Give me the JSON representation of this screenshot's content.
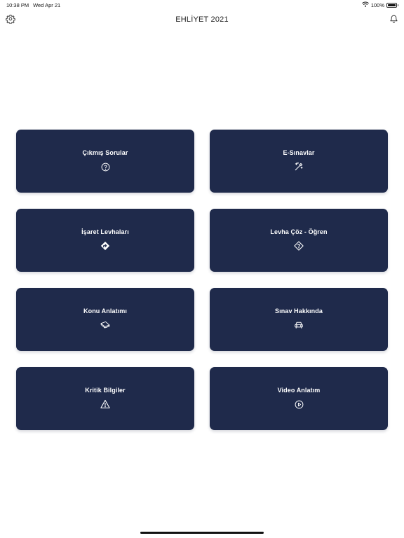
{
  "status": {
    "time": "10:38 PM",
    "date": "Wed Apr 21",
    "battery": "100%"
  },
  "header": {
    "title": "EHLİYET 2021",
    "left_icon": "gear-icon",
    "right_icon": "bell-icon"
  },
  "menu": [
    {
      "label": "Çıkmış Sorular",
      "icon": "question-circle-icon"
    },
    {
      "label": "E-Sınavlar",
      "icon": "magic-wand-icon"
    },
    {
      "label": "İşaret Levhaları",
      "icon": "direction-sign-icon"
    },
    {
      "label": "Levha Çöz - Öğren",
      "icon": "question-diamond-icon"
    },
    {
      "label": "Konu Anlatımı",
      "icon": "book-icon"
    },
    {
      "label": "Sınav Hakkında",
      "icon": "car-icon"
    },
    {
      "label": "Kritik Bilgiler",
      "icon": "warning-triangle-icon"
    },
    {
      "label": "Video Anlatım",
      "icon": "play-circle-icon"
    }
  ],
  "colors": {
    "card_background": "#1f2a4b",
    "card_text": "#ffffff",
    "page_background": "#ffffff"
  }
}
